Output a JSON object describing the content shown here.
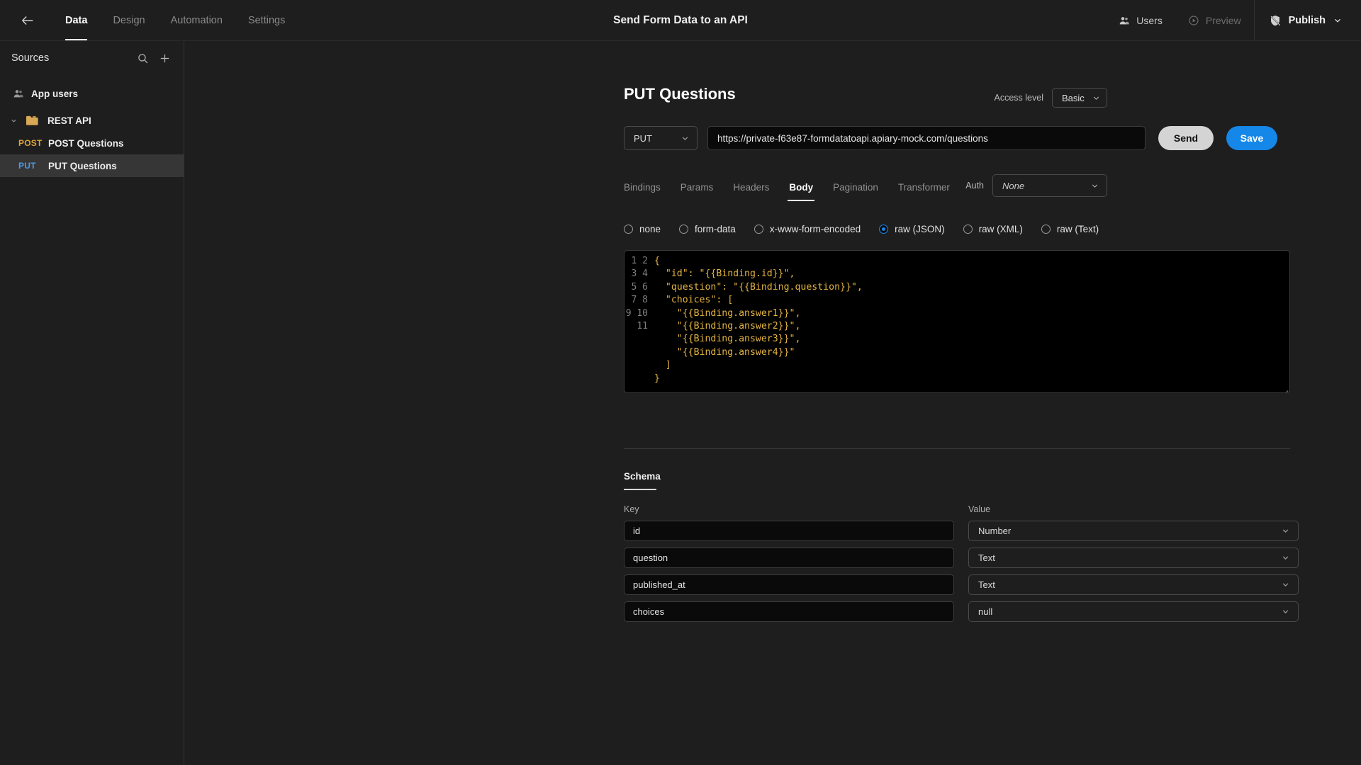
{
  "topbar": {
    "back_icon": "arrow-left-icon",
    "nav": [
      {
        "label": "Data",
        "active": true
      },
      {
        "label": "Design",
        "active": false
      },
      {
        "label": "Automation",
        "active": false
      },
      {
        "label": "Settings",
        "active": false
      }
    ],
    "app_title": "Send Form Data to an API",
    "users_label": "Users",
    "preview_label": "Preview",
    "publish_label": "Publish"
  },
  "sidebar": {
    "title": "Sources",
    "search_icon": "search-icon",
    "add_icon": "plus-icon",
    "items": [
      {
        "label": "App users",
        "kind": "app-users"
      },
      {
        "label": "REST API",
        "kind": "folder",
        "expanded": true
      },
      {
        "method": "POST",
        "label": "POST Questions",
        "kind": "endpoint",
        "active": false
      },
      {
        "method": "PUT",
        "label": "PUT Questions",
        "kind": "endpoint",
        "active": true
      }
    ]
  },
  "main": {
    "page_title": "PUT Questions",
    "access_level_label": "Access level",
    "access_level_value": "Basic",
    "method_value": "PUT",
    "url_value": "https://private-f63e87-formdatatoapi.apiary-mock.com/questions",
    "send_label": "Send",
    "save_label": "Save",
    "tabs": [
      {
        "label": "Bindings",
        "active": false
      },
      {
        "label": "Params",
        "active": false
      },
      {
        "label": "Headers",
        "active": false
      },
      {
        "label": "Body",
        "active": true
      },
      {
        "label": "Pagination",
        "active": false
      },
      {
        "label": "Transformer",
        "active": false
      }
    ],
    "auth_label": "Auth",
    "auth_value": "None",
    "body_types": [
      {
        "label": "none",
        "selected": false
      },
      {
        "label": "form-data",
        "selected": false
      },
      {
        "label": "x-www-form-encoded",
        "selected": false
      },
      {
        "label": "raw (JSON)",
        "selected": true
      },
      {
        "label": "raw (XML)",
        "selected": false
      },
      {
        "label": "raw (Text)",
        "selected": false
      }
    ],
    "editor": {
      "line_numbers": "1\n2\n3\n4\n5\n6\n7\n8\n9\n10\n11",
      "code": "{\n  \"id\": \"{{Binding.id}}\",\n  \"question\": \"{{Binding.question}}\",\n  \"choices\": [\n    \"{{Binding.answer1}}\",\n    \"{{Binding.answer2}}\",\n    \"{{Binding.answer3}}\",\n    \"{{Binding.answer4}}\"\n  ]\n}"
    },
    "schema": {
      "title": "Schema",
      "col_key": "Key",
      "col_value": "Value",
      "rows": [
        {
          "key": "id",
          "value": "Number"
        },
        {
          "key": "question",
          "value": "Text"
        },
        {
          "key": "published_at",
          "value": "Text"
        },
        {
          "key": "choices",
          "value": "null"
        }
      ]
    }
  },
  "colors": {
    "accent_blue": "#1587e8",
    "method_post": "#e0a33a",
    "method_put": "#4d9ae8",
    "code_text": "#e3b341",
    "background": "#1e1e1e"
  }
}
